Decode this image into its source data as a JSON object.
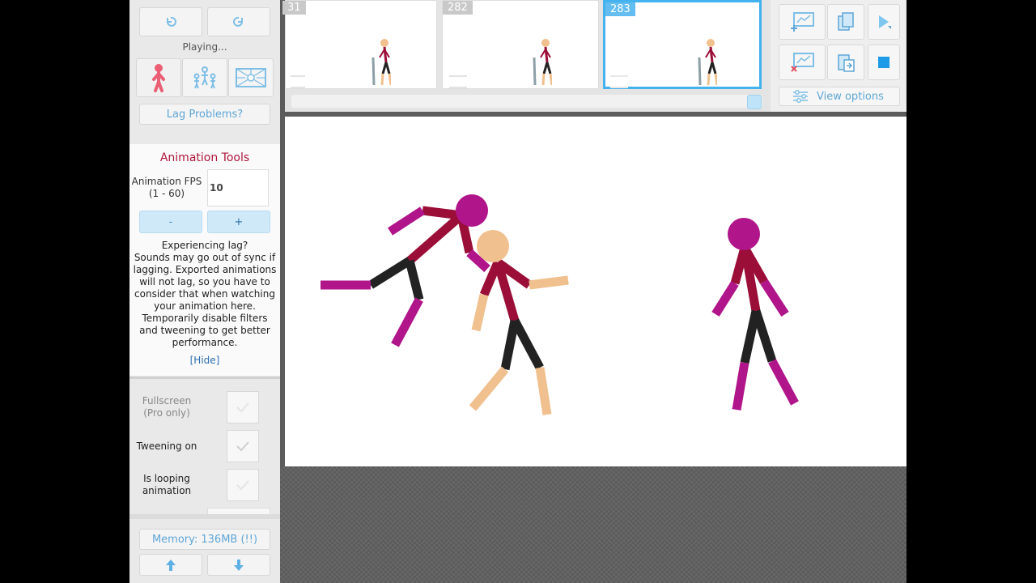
{
  "sidebar": {
    "status": "Playing...",
    "lag_button": "Lag Problems?",
    "tools_title": "Animation Tools",
    "fps_label_1": "Animation FPS",
    "fps_label_2": "(1 - 60)",
    "fps_value": "10",
    "minus_label": "-",
    "plus_label": "+",
    "lag_info": "Experiencing lag?\nSounds may go out of sync if lagging. Exported animations will not lag, so you have to consider that when watching your animation here. Temporarily disable filters and tweening to get better performance.",
    "hide_link": "[Hide]",
    "fullscreen_1": "Fullscreen",
    "fullscreen_2": "(Pro only)",
    "tweening_label": "Tweening on",
    "looping_1": "Is looping",
    "looping_2": "animation",
    "memory": "Memory: 136MB (!!)"
  },
  "frames": [
    {
      "number": "31"
    },
    {
      "number": "282"
    },
    {
      "number": "283",
      "selected": true
    }
  ],
  "controls": {
    "view_options": "View options"
  },
  "colors": {
    "accent": "#44b2ee",
    "title_red": "#b0163c",
    "stick_magenta": "#b0158a",
    "stick_crimson": "#9a0e38",
    "stick_skin": "#f0c08e",
    "stick_black": "#222222"
  },
  "icons": [
    "undo-icon",
    "redo-icon",
    "stickfigure-icon",
    "group-figures-icon",
    "background-icon",
    "up-arrow-icon",
    "down-arrow-icon",
    "add-frame-icon",
    "copy-frame-icon",
    "play-icon",
    "delete-frame-icon",
    "paste-frame-icon",
    "stop-icon",
    "settings-sliders-icon",
    "checkmark-icon"
  ]
}
